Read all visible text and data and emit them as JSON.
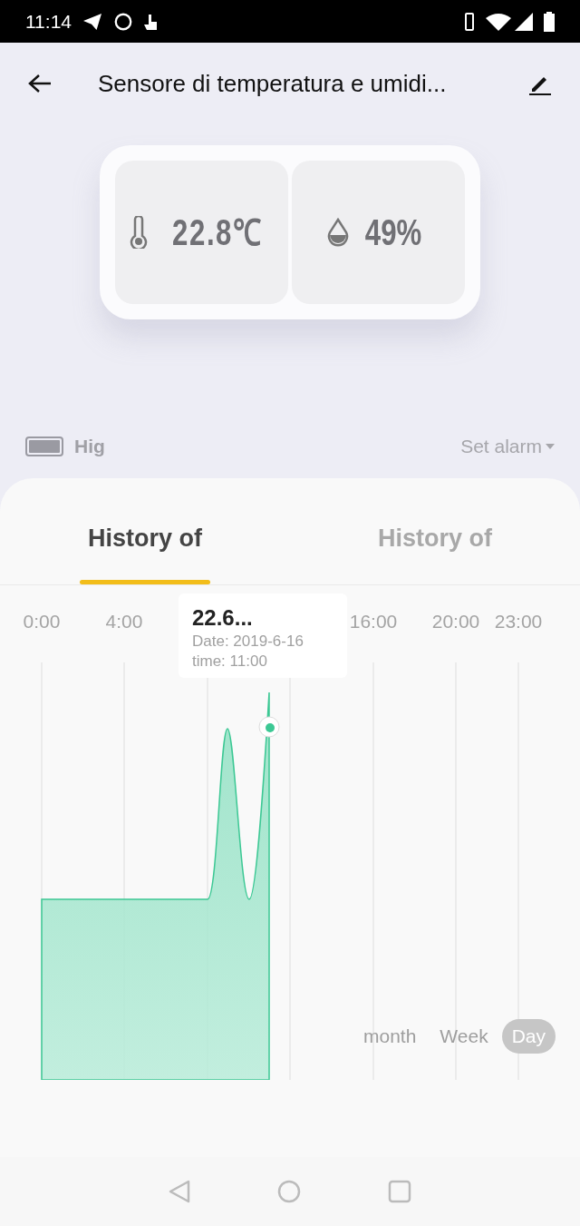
{
  "status_bar": {
    "time": "11:14"
  },
  "header": {
    "title": "Sensore di temperatura e umidi..."
  },
  "device": {
    "temperature": "22.8℃",
    "humidity": "49%"
  },
  "battery": {
    "label": "Hig",
    "level": 1
  },
  "alarm": {
    "label": "Set alarm"
  },
  "tabs": [
    {
      "label": "History of",
      "selected": true
    },
    {
      "label": "History of",
      "selected": false
    }
  ],
  "chart": {
    "x_labels": [
      "0:00",
      "4:00",
      "16:00",
      "20:00",
      "23:00"
    ],
    "tooltip": {
      "value": "22.6...",
      "date": "Date: 2019-6-16",
      "time": "time: 11:00"
    }
  },
  "ranges": [
    {
      "label": "month",
      "selected": false
    },
    {
      "label": "Week",
      "selected": false
    },
    {
      "label": "Day",
      "selected": true
    }
  ]
}
